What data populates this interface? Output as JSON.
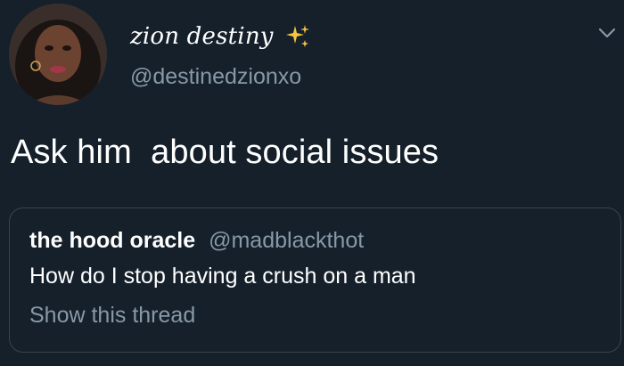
{
  "tweet": {
    "author": {
      "display_name": "zion destiny",
      "handle": "@destinedzionxo",
      "avatar_icon": "avatar-photo",
      "name_emoji_icon": "sparkles-icon"
    },
    "menu_icon": "chevron-down-icon",
    "text": "Ask him  about social issues",
    "quoted_tweet": {
      "author_name": "the hood oracle",
      "author_handle": "@madblackthot",
      "text": "How do I stop having a crush on a man",
      "thread_link": "Show this thread"
    }
  },
  "colors": {
    "background": "#15202b",
    "primary_text": "#ffffff",
    "secondary_text": "#8899a6",
    "border": "#38444d",
    "sparkle": "#f5c542"
  }
}
